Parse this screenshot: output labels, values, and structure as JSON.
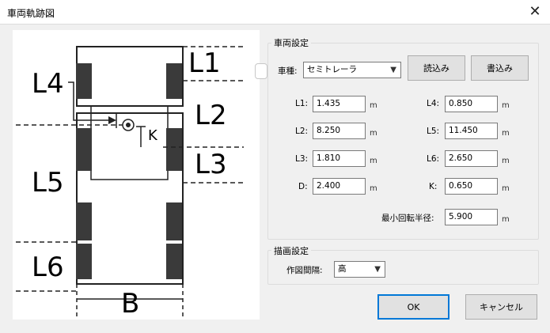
{
  "window": {
    "title": "車両軌跡図",
    "close_glyph": "✕"
  },
  "diagram": {
    "labels": {
      "L1": "L1",
      "L2": "L2",
      "L3": "L3",
      "L4": "L4",
      "L5": "L5",
      "L6": "L6",
      "K": "K",
      "B": "B"
    }
  },
  "vehicle_settings": {
    "group_title": "車両設定",
    "vehicle_type_label": "車種:",
    "vehicle_type_value": "セミトレーラ",
    "load_button": "読込み",
    "write_button": "書込み",
    "fields": [
      {
        "label": "L1:",
        "value": "1.435",
        "unit": "m"
      },
      {
        "label": "L4:",
        "value": "0.850",
        "unit": "m"
      },
      {
        "label": "L2:",
        "value": "8.250",
        "unit": "m"
      },
      {
        "label": "L5:",
        "value": "11.450",
        "unit": "m"
      },
      {
        "label": "L3:",
        "value": "1.810",
        "unit": "m"
      },
      {
        "label": "L6:",
        "value": "2.650",
        "unit": "m"
      },
      {
        "label": "D:",
        "value": "2.400",
        "unit": "m"
      },
      {
        "label": "K:",
        "value": "0.650",
        "unit": "m"
      }
    ],
    "min_turn_radius": {
      "label": "最小回転半径:",
      "value": "5.900",
      "unit": "m"
    }
  },
  "drawing_settings": {
    "group_title": "描画設定",
    "interval_label": "作図間隔:",
    "interval_value": "高"
  },
  "footer": {
    "ok": "OK",
    "cancel": "キャンセル"
  }
}
